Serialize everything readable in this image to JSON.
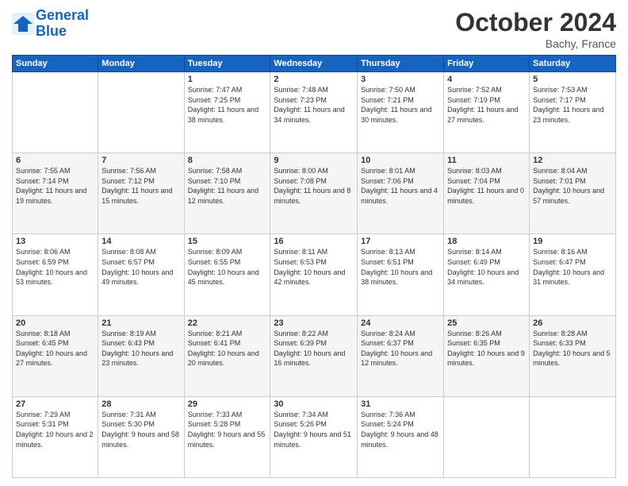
{
  "header": {
    "logo_line1": "General",
    "logo_line2": "Blue",
    "month": "October 2024",
    "location": "Bachy, France"
  },
  "days_of_week": [
    "Sunday",
    "Monday",
    "Tuesday",
    "Wednesday",
    "Thursday",
    "Friday",
    "Saturday"
  ],
  "weeks": [
    [
      {
        "day": "",
        "info": ""
      },
      {
        "day": "",
        "info": ""
      },
      {
        "day": "1",
        "info": "Sunrise: 7:47 AM\nSunset: 7:25 PM\nDaylight: 11 hours and 38 minutes."
      },
      {
        "day": "2",
        "info": "Sunrise: 7:48 AM\nSunset: 7:23 PM\nDaylight: 11 hours and 34 minutes."
      },
      {
        "day": "3",
        "info": "Sunrise: 7:50 AM\nSunset: 7:21 PM\nDaylight: 11 hours and 30 minutes."
      },
      {
        "day": "4",
        "info": "Sunrise: 7:52 AM\nSunset: 7:19 PM\nDaylight: 11 hours and 27 minutes."
      },
      {
        "day": "5",
        "info": "Sunrise: 7:53 AM\nSunset: 7:17 PM\nDaylight: 11 hours and 23 minutes."
      }
    ],
    [
      {
        "day": "6",
        "info": "Sunrise: 7:55 AM\nSunset: 7:14 PM\nDaylight: 11 hours and 19 minutes."
      },
      {
        "day": "7",
        "info": "Sunrise: 7:56 AM\nSunset: 7:12 PM\nDaylight: 11 hours and 15 minutes."
      },
      {
        "day": "8",
        "info": "Sunrise: 7:58 AM\nSunset: 7:10 PM\nDaylight: 11 hours and 12 minutes."
      },
      {
        "day": "9",
        "info": "Sunrise: 8:00 AM\nSunset: 7:08 PM\nDaylight: 11 hours and 8 minutes."
      },
      {
        "day": "10",
        "info": "Sunrise: 8:01 AM\nSunset: 7:06 PM\nDaylight: 11 hours and 4 minutes."
      },
      {
        "day": "11",
        "info": "Sunrise: 8:03 AM\nSunset: 7:04 PM\nDaylight: 11 hours and 0 minutes."
      },
      {
        "day": "12",
        "info": "Sunrise: 8:04 AM\nSunset: 7:01 PM\nDaylight: 10 hours and 57 minutes."
      }
    ],
    [
      {
        "day": "13",
        "info": "Sunrise: 8:06 AM\nSunset: 6:59 PM\nDaylight: 10 hours and 53 minutes."
      },
      {
        "day": "14",
        "info": "Sunrise: 8:08 AM\nSunset: 6:57 PM\nDaylight: 10 hours and 49 minutes."
      },
      {
        "day": "15",
        "info": "Sunrise: 8:09 AM\nSunset: 6:55 PM\nDaylight: 10 hours and 45 minutes."
      },
      {
        "day": "16",
        "info": "Sunrise: 8:11 AM\nSunset: 6:53 PM\nDaylight: 10 hours and 42 minutes."
      },
      {
        "day": "17",
        "info": "Sunrise: 8:13 AM\nSunset: 6:51 PM\nDaylight: 10 hours and 38 minutes."
      },
      {
        "day": "18",
        "info": "Sunrise: 8:14 AM\nSunset: 6:49 PM\nDaylight: 10 hours and 34 minutes."
      },
      {
        "day": "19",
        "info": "Sunrise: 8:16 AM\nSunset: 6:47 PM\nDaylight: 10 hours and 31 minutes."
      }
    ],
    [
      {
        "day": "20",
        "info": "Sunrise: 8:18 AM\nSunset: 6:45 PM\nDaylight: 10 hours and 27 minutes."
      },
      {
        "day": "21",
        "info": "Sunrise: 8:19 AM\nSunset: 6:43 PM\nDaylight: 10 hours and 23 minutes."
      },
      {
        "day": "22",
        "info": "Sunrise: 8:21 AM\nSunset: 6:41 PM\nDaylight: 10 hours and 20 minutes."
      },
      {
        "day": "23",
        "info": "Sunrise: 8:22 AM\nSunset: 6:39 PM\nDaylight: 10 hours and 16 minutes."
      },
      {
        "day": "24",
        "info": "Sunrise: 8:24 AM\nSunset: 6:37 PM\nDaylight: 10 hours and 12 minutes."
      },
      {
        "day": "25",
        "info": "Sunrise: 8:26 AM\nSunset: 6:35 PM\nDaylight: 10 hours and 9 minutes."
      },
      {
        "day": "26",
        "info": "Sunrise: 8:28 AM\nSunset: 6:33 PM\nDaylight: 10 hours and 5 minutes."
      }
    ],
    [
      {
        "day": "27",
        "info": "Sunrise: 7:29 AM\nSunset: 5:31 PM\nDaylight: 10 hours and 2 minutes."
      },
      {
        "day": "28",
        "info": "Sunrise: 7:31 AM\nSunset: 5:30 PM\nDaylight: 9 hours and 58 minutes."
      },
      {
        "day": "29",
        "info": "Sunrise: 7:33 AM\nSunset: 5:28 PM\nDaylight: 9 hours and 55 minutes."
      },
      {
        "day": "30",
        "info": "Sunrise: 7:34 AM\nSunset: 5:26 PM\nDaylight: 9 hours and 51 minutes."
      },
      {
        "day": "31",
        "info": "Sunrise: 7:36 AM\nSunset: 5:24 PM\nDaylight: 9 hours and 48 minutes."
      },
      {
        "day": "",
        "info": ""
      },
      {
        "day": "",
        "info": ""
      }
    ]
  ]
}
